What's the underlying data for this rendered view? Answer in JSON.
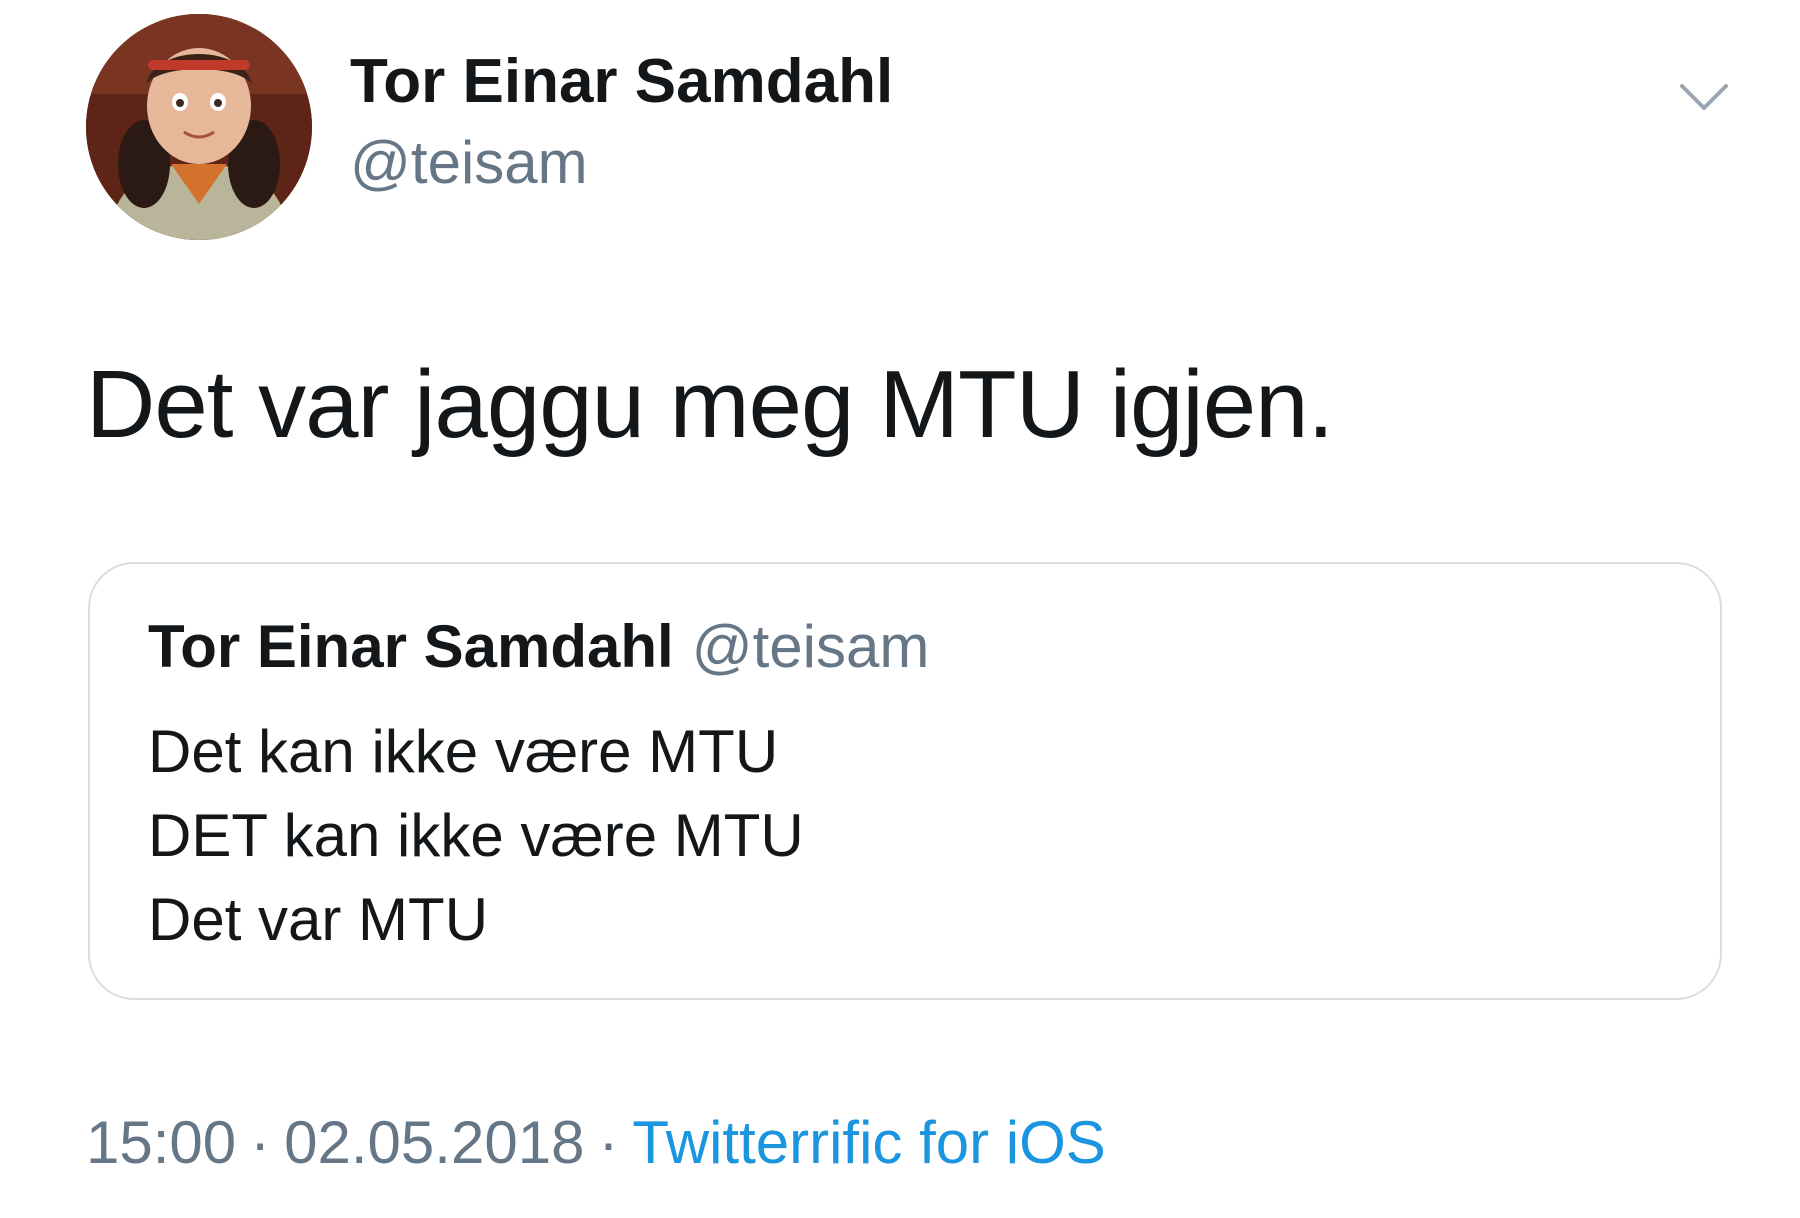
{
  "tweet": {
    "author": {
      "name": "Tor Einar Samdahl",
      "handle": "@teisam"
    },
    "text": "Det var jaggu meg MTU igjen.",
    "quoted": {
      "name": "Tor Einar Samdahl",
      "handle": "@teisam",
      "lines": [
        "Det kan ikke være MTU",
        "DET kan ikke være MTU",
        "Det var MTU"
      ]
    },
    "meta": {
      "time": "15:00",
      "separator": "·",
      "date": "02.05.2018",
      "source": "Twitterrific for iOS"
    }
  },
  "icons": {
    "avatar": "profile-photo",
    "caret": "chevron-down-icon"
  },
  "colors": {
    "text": "#14171a",
    "secondary": "#657786",
    "link": "#1b95e0",
    "border": "#d8dee3"
  }
}
